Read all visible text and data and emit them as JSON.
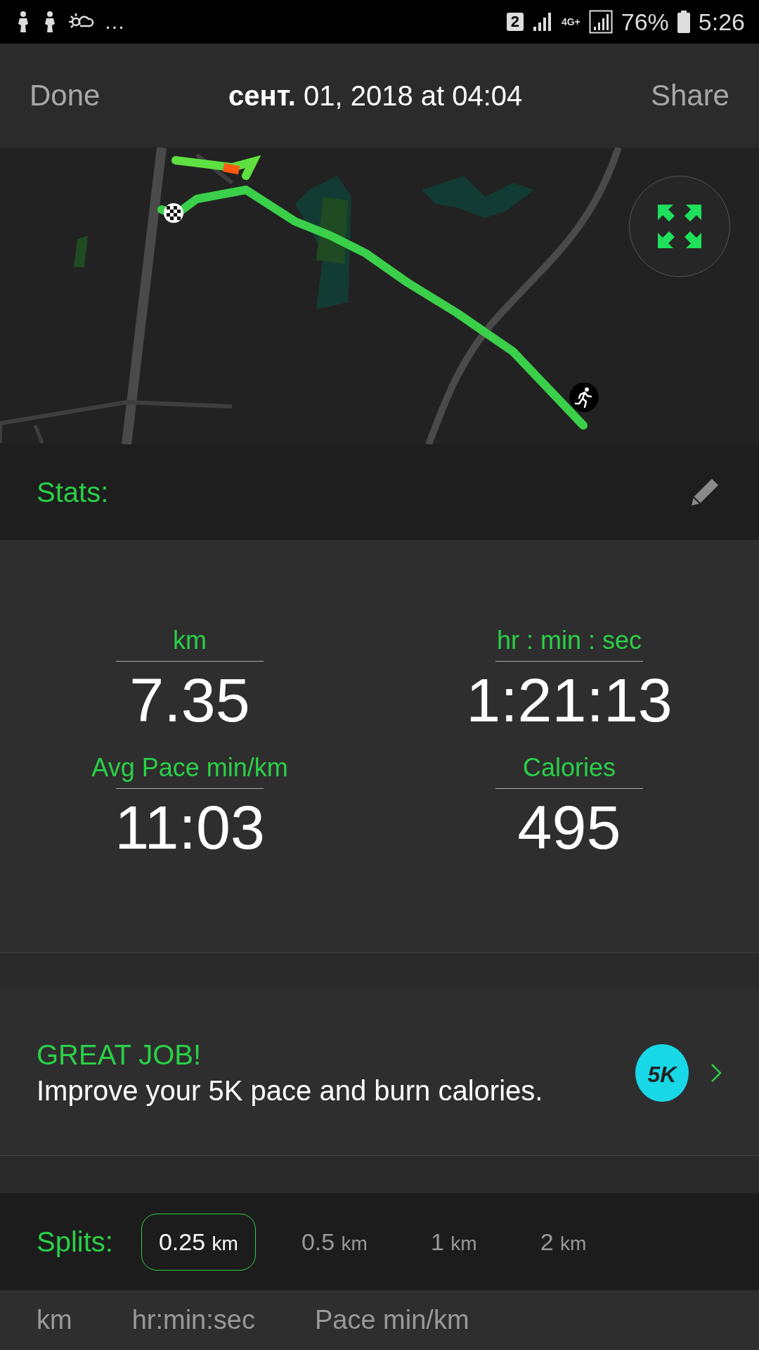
{
  "status_bar": {
    "more": "…",
    "sim": "2",
    "network": "4G+",
    "battery": "76%",
    "time": "5:26"
  },
  "header": {
    "left": "Done",
    "title": "**сент.** 01, 2018 at 04:04",
    "right": "Share"
  },
  "stats": {
    "title": "Stats:",
    "items": [
      {
        "label": "km",
        "value": "7.35"
      },
      {
        "label": "hr : min : sec",
        "value": "1:21:13"
      },
      {
        "label": "Avg Pace min/km",
        "value": "11:03"
      },
      {
        "label": "Calories",
        "value": "495"
      }
    ]
  },
  "promo": {
    "title": "GREAT JOB!",
    "text": "Improve your 5K pace and burn calories.",
    "badge": "5K"
  },
  "splits": {
    "title": "Splits:",
    "options": [
      {
        "value": "0.25",
        "unit": "km",
        "selected": true
      },
      {
        "value": "0.5",
        "unit": "km",
        "selected": false
      },
      {
        "value": "1",
        "unit": "km",
        "selected": false
      },
      {
        "value": "2",
        "unit": "km",
        "selected": false
      }
    ],
    "columns": [
      "km",
      "hr:min:sec",
      "Pace min/km"
    ]
  }
}
